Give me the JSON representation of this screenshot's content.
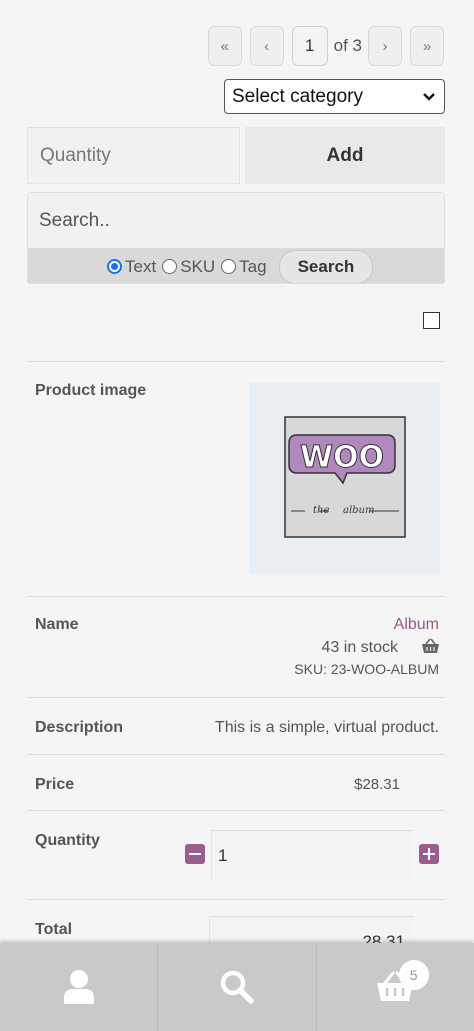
{
  "pagination": {
    "first": "«",
    "prev": "‹",
    "current": "1",
    "of_label": "of 3",
    "next": "›",
    "last": "»"
  },
  "category_select": {
    "selected": "Select category"
  },
  "quick_add": {
    "quantity_placeholder": "Quantity",
    "add_label": "Add"
  },
  "search": {
    "placeholder": "Search..",
    "options": [
      {
        "label": "Text",
        "checked": true
      },
      {
        "label": "SKU",
        "checked": false
      },
      {
        "label": "Tag",
        "checked": false
      }
    ],
    "button_label": "Search"
  },
  "product": {
    "image_label": "Product image",
    "image_text_main": "WOO",
    "image_text_sub1": "the",
    "image_text_sub2": "album",
    "name_label": "Name",
    "name": "Album",
    "stock": "43 in stock",
    "sku": "SKU: 23-WOO-ALBUM",
    "description_label": "Description",
    "description": "This is a simple, virtual product.",
    "price_label": "Price",
    "price": "$28.31",
    "quantity_label": "Quantity",
    "quantity": "1",
    "total_label": "Total",
    "total": "28.31"
  },
  "bottom_nav": {
    "items": [
      {
        "icon": "user-icon"
      },
      {
        "icon": "search-icon"
      },
      {
        "icon": "cart-icon",
        "badge": "5"
      }
    ]
  },
  "colors": {
    "accent": "#9b5c8f",
    "link": "#96588a",
    "radio": "#1a73e8"
  }
}
